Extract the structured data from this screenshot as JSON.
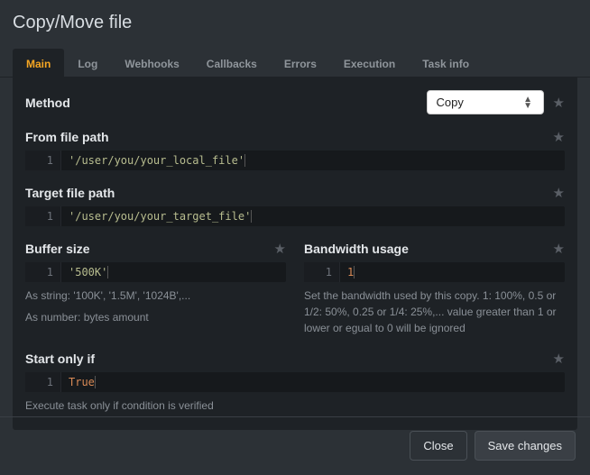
{
  "title": "Copy/Move file",
  "tabs": {
    "main": "Main",
    "log": "Log",
    "webhooks": "Webhooks",
    "callbacks": "Callbacks",
    "errors": "Errors",
    "execution": "Execution",
    "taskinfo": "Task info"
  },
  "fields": {
    "method": {
      "label": "Method",
      "value": "Copy"
    },
    "from_path": {
      "label": "From file path",
      "line": "1",
      "value": "'/user/you/your_local_file'"
    },
    "target_path": {
      "label": "Target file path",
      "line": "1",
      "value": "'/user/you/your_target_file'"
    },
    "buffer_size": {
      "label": "Buffer size",
      "line": "1",
      "value": "'500K'",
      "help1": "As string: '100K', '1.5M', '1024B',...",
      "help2": "As number: bytes amount"
    },
    "bandwidth": {
      "label": "Bandwidth usage",
      "line": "1",
      "value": "1",
      "help": "Set the bandwidth used by this copy. 1: 100%, 0.5 or 1/2: 50%, 0.25 or 1/4: 25%,... value greater than 1 or lower or egual to 0 will be ignored"
    },
    "start_if": {
      "label": "Start only if",
      "line": "1",
      "value": "True",
      "help": "Execute task only if condition is verified"
    }
  },
  "buttons": {
    "close": "Close",
    "save": "Save changes"
  }
}
